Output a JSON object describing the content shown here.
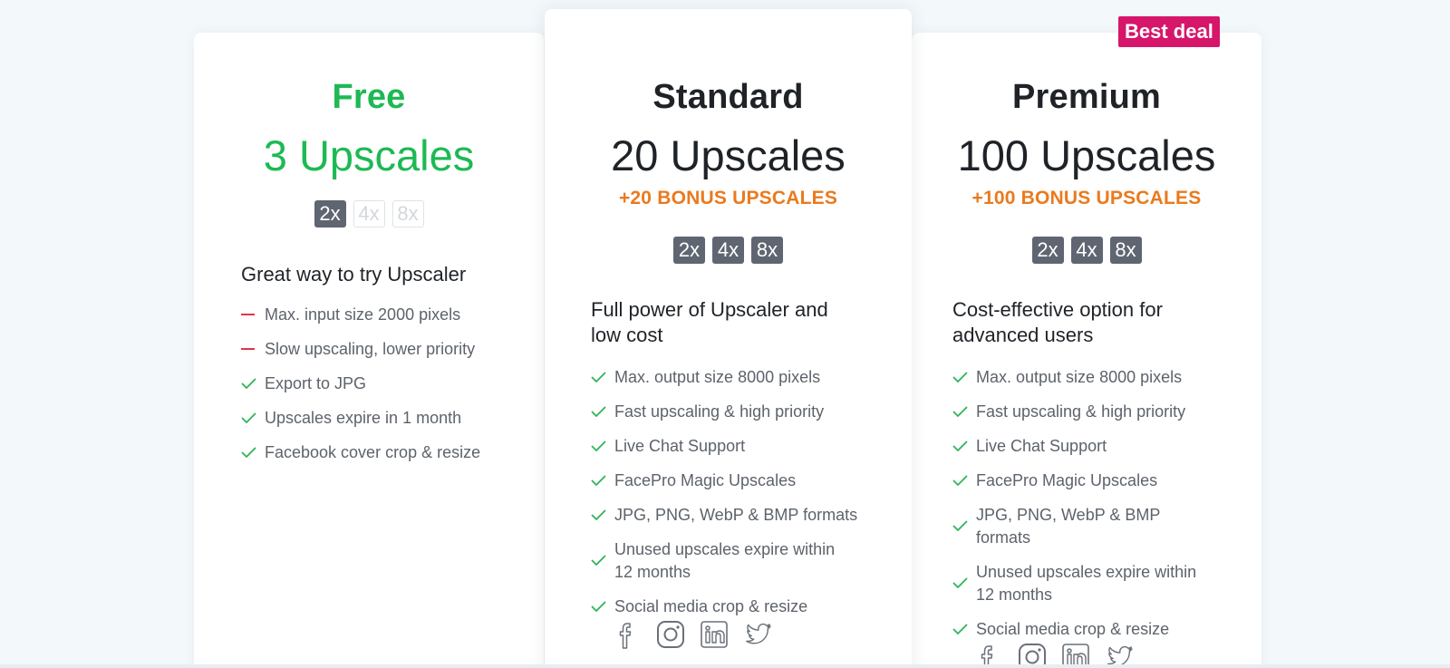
{
  "badge": "Best deal",
  "colors": {
    "accent_green": "#1db954",
    "bonus_orange": "#ea7a1e",
    "badge_pink": "#d6166a",
    "minus_red": "#e0334f"
  },
  "plans": {
    "free": {
      "name": "Free",
      "amount": "3 Upscales",
      "factors": [
        {
          "label": "2x",
          "enabled": true
        },
        {
          "label": "4x",
          "enabled": false
        },
        {
          "label": "8x",
          "enabled": false
        }
      ],
      "subtitle": "Great way to try Upscaler",
      "features": [
        {
          "text": "Max. input size 2000 pixels",
          "icon": "minus-icon"
        },
        {
          "text": "Slow upscaling, lower priority",
          "icon": "minus-icon"
        },
        {
          "text": "Export to JPG",
          "icon": "check-icon"
        },
        {
          "text": "Upscales expire in 1 month",
          "icon": "check-icon"
        },
        {
          "text": "Facebook cover crop & resize",
          "icon": "check-icon"
        }
      ]
    },
    "standard": {
      "name": "Standard",
      "amount": "20 Upscales",
      "bonus": "+20 BONUS UPSCALES",
      "factors": [
        {
          "label": "2x",
          "enabled": true
        },
        {
          "label": "4x",
          "enabled": true
        },
        {
          "label": "8x",
          "enabled": true
        }
      ],
      "subtitle": [
        "Full power of Upscaler and",
        "low cost"
      ],
      "features": [
        {
          "text": "Max. output size 8000 pixels",
          "icon": "check-icon"
        },
        {
          "text": "Fast upscaling & high priority",
          "icon": "check-icon"
        },
        {
          "text": "Live Chat Support",
          "icon": "check-icon"
        },
        {
          "text": "FacePro Magic Upscales",
          "icon": "check-icon"
        },
        {
          "text": "JPG, PNG, WebP & BMP formats",
          "icon": "check-icon"
        },
        {
          "text": [
            "Unused upscales expire within",
            "12 months"
          ],
          "icon": "check-icon"
        },
        {
          "text": "Social media crop & resize",
          "icon": "check-icon"
        }
      ],
      "social_icons": [
        "facebook-icon",
        "instagram-icon",
        "linkedin-icon",
        "twitter-icon"
      ]
    },
    "premium": {
      "name": "Premium",
      "amount": "100 Upscales",
      "bonus": "+100 BONUS UPSCALES",
      "factors": [
        {
          "label": "2x",
          "enabled": true
        },
        {
          "label": "4x",
          "enabled": true
        },
        {
          "label": "8x",
          "enabled": true
        }
      ],
      "subtitle": [
        "Cost-effective option for",
        "advanced users"
      ],
      "features": [
        {
          "text": "Max. output size 8000 pixels",
          "icon": "check-icon"
        },
        {
          "text": "Fast upscaling & high priority",
          "icon": "check-icon"
        },
        {
          "text": "Live Chat Support",
          "icon": "check-icon"
        },
        {
          "text": "FacePro Magic Upscales",
          "icon": "check-icon"
        },
        {
          "text": [
            "JPG, PNG, WebP & BMP",
            "formats"
          ],
          "icon": "check-icon"
        },
        {
          "text": [
            "Unused upscales expire within",
            "12 months"
          ],
          "icon": "check-icon"
        },
        {
          "text": "Social media crop & resize",
          "icon": "check-icon"
        }
      ],
      "social_icons": [
        "facebook-icon",
        "instagram-icon",
        "linkedin-icon",
        "twitter-icon"
      ]
    }
  }
}
